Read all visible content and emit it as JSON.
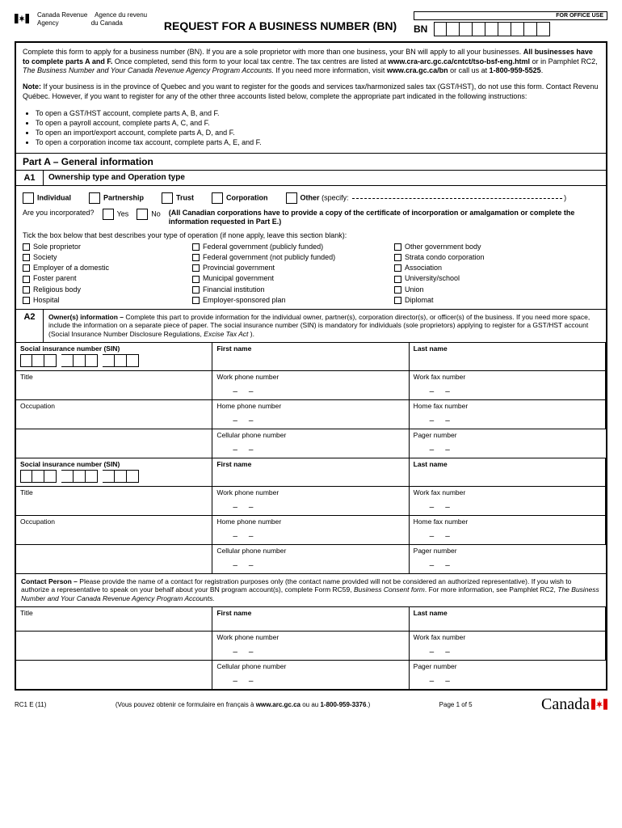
{
  "header": {
    "agency_en1": "Canada Revenue",
    "agency_en2": "Agency",
    "agency_fr1": "Agence du revenu",
    "agency_fr2": "du Canada",
    "title": "REQUEST FOR A BUSINESS NUMBER (BN)",
    "office_use": "FOR OFFICE USE",
    "bn_label": "BN"
  },
  "intro": {
    "p1a": "Complete this form to apply for a business number (BN). If you are a sole proprietor with more than one business, your BN will apply to all your businesses. ",
    "p1b": "All businesses have to complete parts A and F.",
    "p1c": " Once completed, send this form to your local tax centre. The tax centres are listed at ",
    "p1d": "www.cra-arc.gc.ca/cntct/tso-bsf-eng.html",
    "p1e": " or in Pamphlet RC2, ",
    "p1f": "The Business Number and Your Canada Revenue Agency Program Accounts.",
    "p1g": " If you need more information, visit ",
    "p1h": "www.cra.gc.ca/bn",
    "p1i": " or call us at ",
    "p1j": "1-800-959-5525",
    "p1k": ".",
    "note_label": "Note:",
    "note": " If your business is in the province of Quebec and you want to register for the goods and services tax/harmonized sales tax (GST/HST), do not use this form. Contact Revenu Québec. However, if you want to register for any of the other three accounts listed below, complete the appropriate part indicated in the following instructions:",
    "bullets": [
      "To open a GST/HST account, complete parts A, B, and F.",
      "To open a payroll account, complete parts A, C, and F.",
      "To open an import/export account, complete parts A, D, and F.",
      "To open a corporation income tax account, complete parts A, E, and F."
    ]
  },
  "partA": {
    "title": "Part A – General information",
    "a1": {
      "code": "A1",
      "title": "Ownership type and Operation type",
      "types": [
        "Individual",
        "Partnership",
        "Trust",
        "Corporation"
      ],
      "other": "Other",
      "specify": "(specify:",
      "incorp_q": "Are you incorporated?",
      "yes": "Yes",
      "no": "No",
      "incorp_note": "(All Canadian corporations have to provide a copy of the certificate of incorporation or amalgamation or complete the information requested in Part E.)",
      "tick_instr": "Tick the box below that best describes your type of operation (if none apply, leave this section blank):",
      "ops_col1": [
        "Sole proprietor",
        "Society",
        "Employer of a domestic",
        "Foster parent",
        "Religious body",
        "Hospital"
      ],
      "ops_col2": [
        "Federal government (publicly funded)",
        "Federal government (not publicly funded)",
        "Provincial government",
        "Municipal government",
        "Financial institution",
        "Employer-sponsored plan"
      ],
      "ops_col3": [
        "Other government body",
        "Strata condo corporation",
        "Association",
        "University/school",
        "Union",
        "Diplomat"
      ]
    },
    "a2": {
      "code": "A2",
      "desc_a": "Owner(s) information – ",
      "desc_b": "Complete this part to provide information for the individual owner, partner(s), corporation director(s), or officer(s) of the business. If you need more space, include the information on a separate piece of paper. The social insurance number (SIN) is mandatory for individuals (sole proprietors) applying to register for a GST/HST account (Social Insurance Number Disclosure Regulations, ",
      "desc_c": "Excise Tax Act",
      "desc_d": " ).",
      "labels": {
        "sin": "Social insurance number (SIN)",
        "first": "First name",
        "last": "Last name",
        "title": "Title",
        "workphone": "Work phone number",
        "workfax": "Work fax number",
        "occupation": "Occupation",
        "homephone": "Home phone number",
        "homefax": "Home fax number",
        "cellphone": "Cellular phone number",
        "pager": "Pager number"
      }
    },
    "contact": {
      "head": "Contact Person – ",
      "desc": "Please provide the name of a contact for registration purposes only (the contact name provided will not be considered an authorized representative). If you wish to authorize a representative to speak on your behalf about your BN program account(s), complete Form RC59, ",
      "desc_i": "Business Consent form",
      "desc2": ". For more information, see Pamphlet RC2, ",
      "desc2_i": "The Business Number and Your Canada Revenue Agency Program Accounts."
    }
  },
  "footer": {
    "form_id": "RC1 E (11)",
    "french_a": "(Vous pouvez obtenir ce formulaire en français à ",
    "french_b": "www.arc.gc.ca",
    "french_c": " ou au ",
    "french_d": "1-800-959-3376",
    "french_e": ".)",
    "page": "Page 1 of 5",
    "wordmark": "Canada"
  }
}
